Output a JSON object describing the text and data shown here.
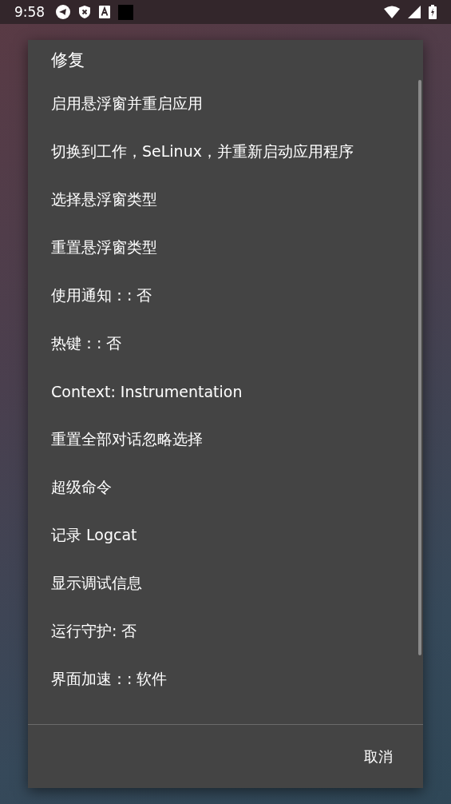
{
  "status_bar": {
    "time": "9:58"
  },
  "dialog": {
    "title": "修复",
    "items": [
      {
        "label": "启用悬浮窗并重启应用"
      },
      {
        "label": "切换到工作，SeLinux，并重新启动应用程序"
      },
      {
        "label": "选择悬浮窗类型"
      },
      {
        "label": "重置悬浮窗类型"
      },
      {
        "label": "使用通知：: 否"
      },
      {
        "label": "热键：: 否"
      },
      {
        "label": "Context: Instrumentation"
      },
      {
        "label": "重置全部对话忽略选择"
      },
      {
        "label": "超级命令"
      },
      {
        "label": "记录 Logcat"
      },
      {
        "label": "显示调试信息"
      },
      {
        "label": "运行守护: 否"
      },
      {
        "label": "界面加速：: 软件"
      }
    ],
    "buttons": [
      "取消"
    ]
  }
}
